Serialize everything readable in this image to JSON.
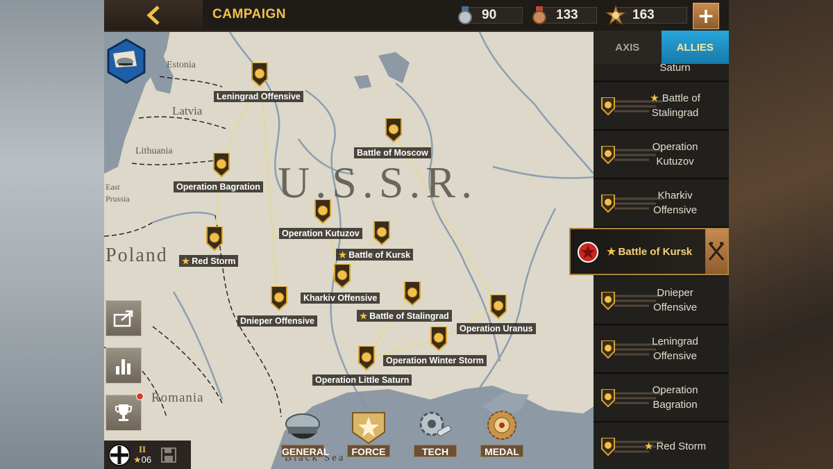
{
  "topbar": {
    "title": "CAMPAIGN",
    "resources": [
      {
        "icon": "silver-medal-icon",
        "value": "90"
      },
      {
        "icon": "bronze-medal-icon",
        "value": "133"
      },
      {
        "icon": "star-burst-icon",
        "value": "163"
      }
    ],
    "plus": "+"
  },
  "map": {
    "ussr": "U.S.S.R.",
    "countries": {
      "estonia": "Estonia",
      "latvia": "Latvia",
      "lithuania": "Lithuania",
      "poland": "Poland",
      "romania": "Romania",
      "east_prussia_1": "East",
      "east_prussia_2": "Prussia",
      "black_sea": "Black Sea"
    },
    "nodes": [
      {
        "label": "Leningrad Offensive",
        "star": ""
      },
      {
        "label": "Battle of Moscow",
        "star": ""
      },
      {
        "label": "Operation Bagration",
        "star": ""
      },
      {
        "label": "Operation Kutuzov",
        "star": ""
      },
      {
        "label": "Battle of Kursk",
        "star": "★"
      },
      {
        "label": "Red Storm",
        "star": "★"
      },
      {
        "label": "Kharkiv Offensive",
        "star": ""
      },
      {
        "label": "Dnieper Offensive",
        "star": ""
      },
      {
        "label": "Battle of Stalingrad",
        "star": "★"
      },
      {
        "label": "Operation Uranus",
        "star": ""
      },
      {
        "label": "Operation Winter Storm",
        "star": ""
      },
      {
        "label": "Operation Little Saturn",
        "star": ""
      }
    ]
  },
  "sidebar": {
    "tabs": {
      "axis": "AXIS",
      "allies": "ALLIES"
    },
    "items": [
      {
        "label": "Saturn",
        "star": ""
      },
      {
        "label": "Battle of\nStalingrad",
        "star": "★"
      },
      {
        "label": "Operation\nKutuzov",
        "star": ""
      },
      {
        "label": "Kharkiv\nOffensive",
        "star": ""
      },
      {
        "label": "Battle of Kursk",
        "star": "★"
      },
      {
        "label": "Dnieper\nOffensive",
        "star": ""
      },
      {
        "label": "Leningrad\nOffensive",
        "star": ""
      },
      {
        "label": "Operation\nBagration",
        "star": ""
      },
      {
        "label": "Red Storm",
        "star": "★"
      }
    ]
  },
  "dock": [
    {
      "label": "GENERAL",
      "icon": "general-cap-icon"
    },
    {
      "label": "FORCE",
      "icon": "force-star-icon"
    },
    {
      "label": "TECH",
      "icon": "gear-wrench-icon"
    },
    {
      "label": "MEDAL",
      "icon": "medal-icon"
    }
  ],
  "profile": {
    "rank": "II",
    "level": "06",
    "level_star": "★"
  },
  "colors": {
    "accent_gold": "#f2c04a",
    "allies_blue": "#2aa6db",
    "land": "#ddd7c8",
    "sea": "#8a96a3"
  }
}
